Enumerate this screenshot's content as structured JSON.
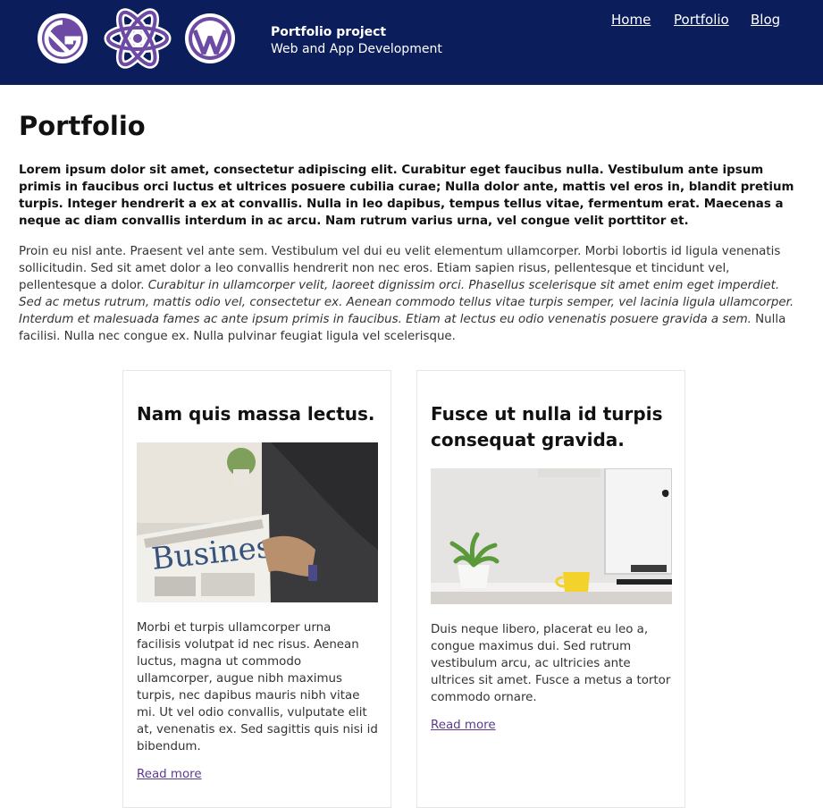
{
  "header": {
    "site_title": "Portfolio project",
    "site_subtitle": "Web and App Development",
    "logos": [
      "gatsby-logo",
      "react-logo",
      "wordpress-logo"
    ],
    "nav": [
      {
        "label": "Home"
      },
      {
        "label": "Portfolio"
      },
      {
        "label": "Blog"
      }
    ],
    "colors": {
      "background": "#0b1e5b",
      "logo": "#6d4aa3"
    }
  },
  "main": {
    "title": "Portfolio",
    "intro_bold": "Lorem ipsum dolor sit amet, consectetur adipiscing elit. Curabitur eget faucibus nulla. Vestibulum ante ipsum primis in faucibus orci luctus et ultrices posuere cubilia curae; Nulla dolor ante, mattis vel eros in, blandit pretium turpis. Integer hendrerit a ex at convallis. Nulla in leo dapibus, tempus tellus vitae, fermentum erat. Maecenas a neque ac diam convallis interdum in ac arcu. Nam rutrum varius urna, vel congue velit porttitor et.",
    "intro_start": "Proin eu nisl ante. Praesent vel ante sem. Vestibulum vel dui eu velit elementum ullamcorper. Morbi lobortis id ligula venenatis sollicitudin. Sed sit amet dolor a leo convallis hendrerit non nec eros. Etiam sapien risus, pellentesque et tincidunt vel, pellentesque a dolor. ",
    "intro_italic": "Curabitur in ullamcorper velit, laoreet dignissim orci. Phasellus scelerisque sit amet enim eget imperdiet. Sed ac metus rutrum, mattis odio vel, consectetur ex. Aenean commodo tellus vitae turpis semper, vel lacinia ligula ullamcorper. Interdum et malesuada fames ac ante ipsum primis in faucibus. Etiam at lectus eu odio venenatis posuere gravida a sem.",
    "intro_end": " Nulla facilisi. Nulla nec congue ex. Nulla pulvinar feugiat ligula vel scelerisque.",
    "cards": [
      {
        "title": "Nam quis massa lectus.",
        "image": "business-newspaper-photo",
        "image_caption": "Business",
        "text": "Morbi et turpis ullamcorper urna facilisis volutpat id nec risus. Aenean luctus, magna ut commodo ullamcorper, augue nibh maximus turpis, nec dapibus mauris nibh vitae mi. Ut vel odio convallis, vulputate elit at, venenatis ex. Sed sagittis quis nisi id bibendum.",
        "link": "Read more"
      },
      {
        "title": "Fusce ut nulla id turpis consequat gravida.",
        "image": "desk-computer-plant-photo",
        "text": "Duis neque libero, placerat eu leo a, congue maximus dui. Sed rutrum vestibulum arcu, ac ultricies ante ultrices sit amet. Fusce a metus a tortor commodo ornare.",
        "link": "Read more"
      }
    ]
  }
}
